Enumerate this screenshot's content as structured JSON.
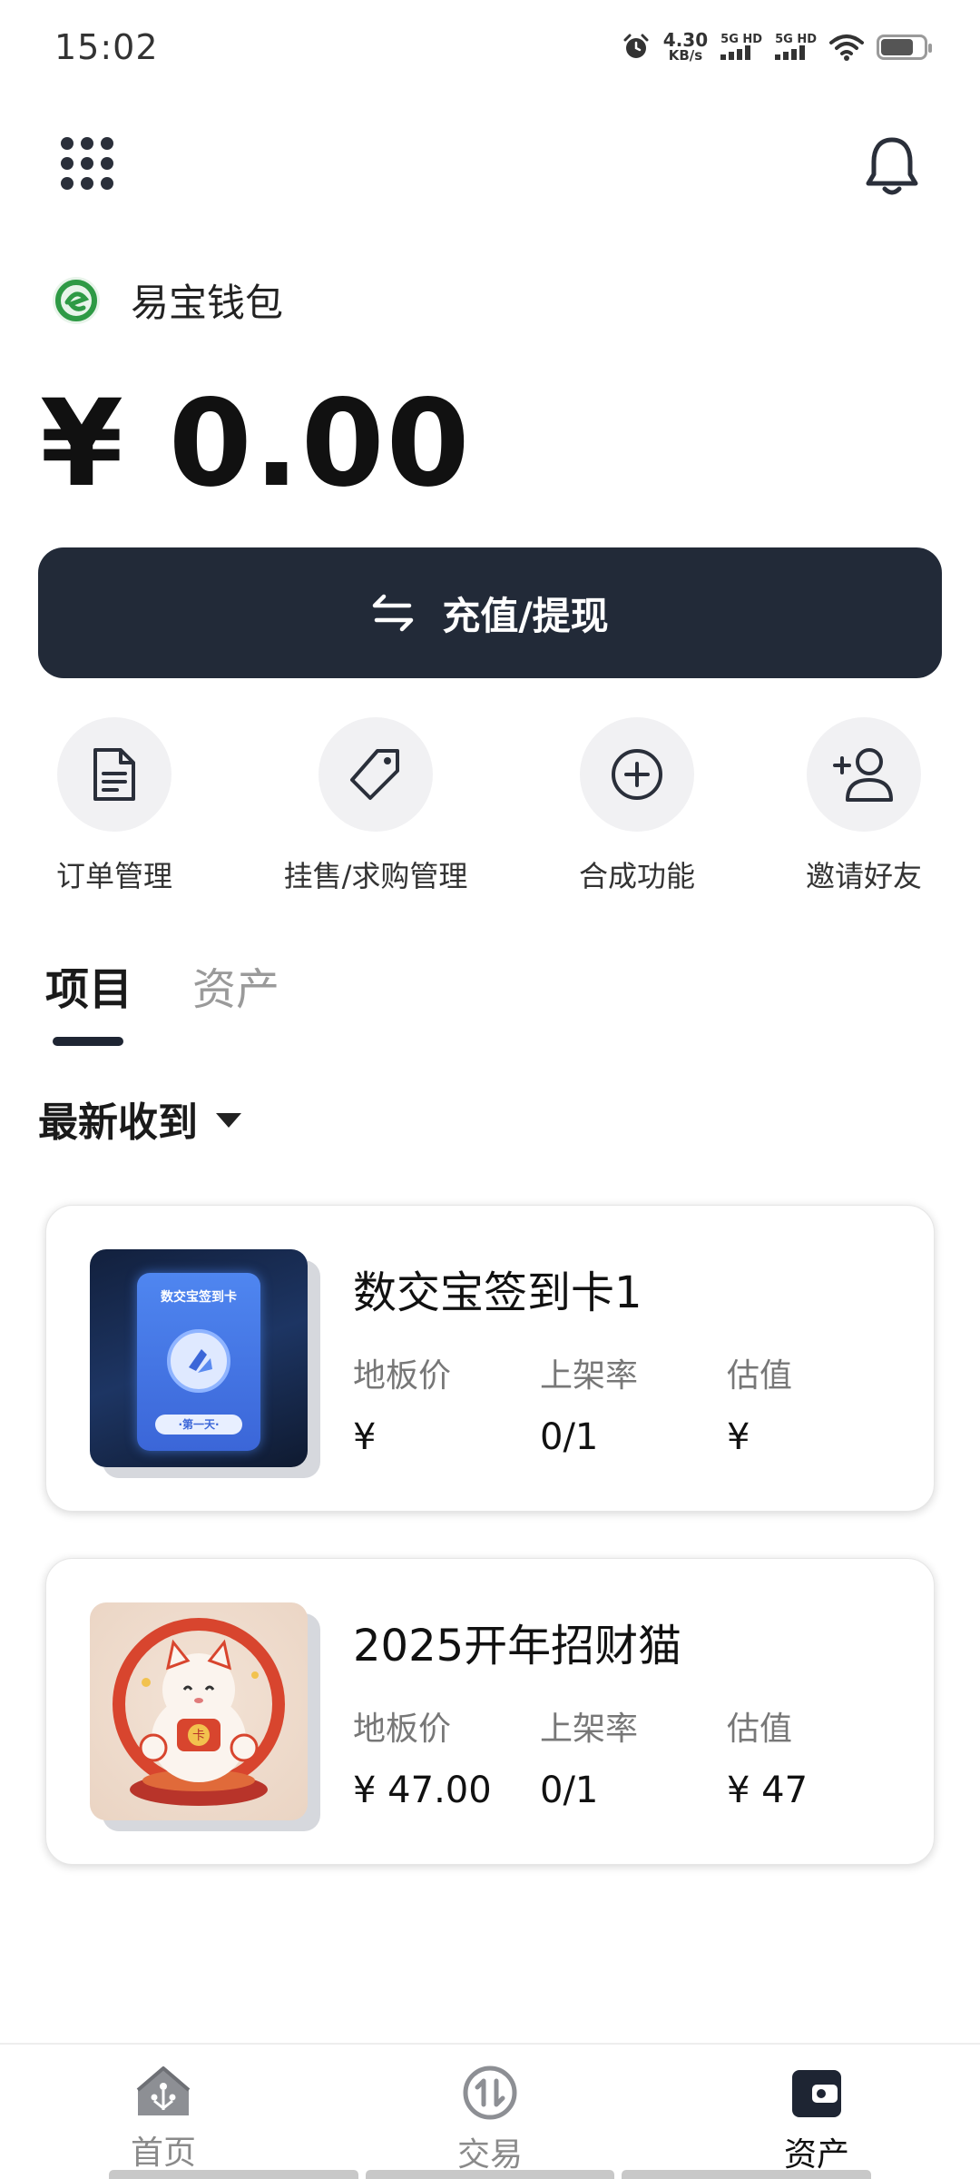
{
  "status_bar": {
    "time": "15:02",
    "net_speed_value": "4.30",
    "net_speed_unit": "KB/s",
    "sim1_label": "5G HD",
    "sim2_label": "5G HD",
    "icons": [
      "alarm-icon",
      "signal-icon",
      "signal-icon",
      "wifi-icon",
      "battery-icon"
    ]
  },
  "header": {
    "apps_icon": "grid-dots-icon",
    "notifications_icon": "bell-icon"
  },
  "wallet": {
    "name": "易宝钱包",
    "logo_icon": "yibao-logo-icon",
    "balance": "¥ 0.00"
  },
  "primary_action": {
    "label": "充值/提现",
    "icon": "swap-arrows-icon"
  },
  "quick_actions": [
    {
      "label": "订单管理",
      "icon": "document-icon"
    },
    {
      "label": "挂售/求购管理",
      "icon": "tag-icon"
    },
    {
      "label": "合成功能",
      "icon": "plus-circle-icon"
    },
    {
      "label": "邀请好友",
      "icon": "add-user-icon"
    }
  ],
  "tabs": [
    {
      "label": "项目",
      "active": true
    },
    {
      "label": "资产",
      "active": false
    }
  ],
  "sort": {
    "label": "最新收到"
  },
  "stat_labels": {
    "floor_price": "地板价",
    "listing_rate": "上架率",
    "valuation": "估值"
  },
  "items": [
    {
      "title": "数交宝签到卡1",
      "floor_price": "¥",
      "listing_rate": "0/1",
      "valuation": "¥",
      "thumb_text_top": "数交宝签到卡",
      "thumb_text_bottom": "·第一天·"
    },
    {
      "title": "2025开年招财猫",
      "floor_price": "¥ 47.00",
      "listing_rate": "0/1",
      "valuation": "¥ 47",
      "thumb_badge": "卡"
    }
  ],
  "bottom_nav": [
    {
      "label": "首页",
      "icon": "home-icon",
      "active": false
    },
    {
      "label": "交易",
      "icon": "exchange-icon",
      "active": false
    },
    {
      "label": "资产",
      "icon": "wallet-icon",
      "active": true
    }
  ],
  "colors": {
    "primary_dark": "#222a38",
    "logo_green": "#2e9a45",
    "muted_text": "#777777"
  }
}
